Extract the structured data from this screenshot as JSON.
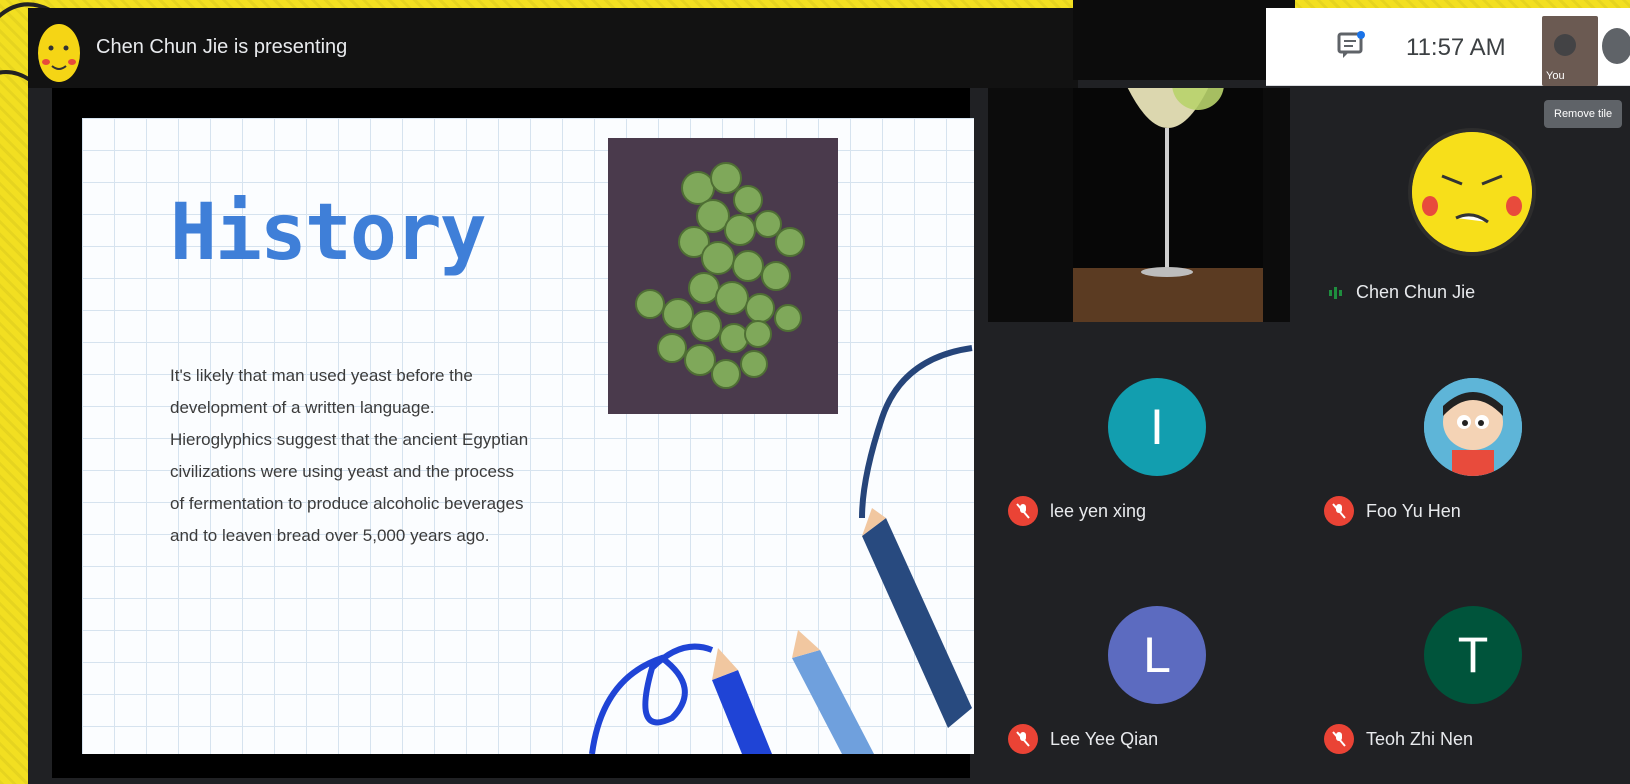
{
  "presenter_bar": {
    "text": "Chen Chun Jie is presenting"
  },
  "slide": {
    "title": "History",
    "body_lines": [
      "It's likely that man used yeast before the",
      "development of a written language.",
      "Hieroglyphics suggest that the ancient Egyptian",
      "civilizations were using yeast and the process",
      "of fermentation to produce alcoholic beverages",
      "and to leaven bread over 5,000 years ago."
    ]
  },
  "toolbar": {
    "clock": "11:57 AM",
    "self_label": "You",
    "remove_tile_tooltip": "Remove tile"
  },
  "tiles": {
    "chen": {
      "name": "Chen Chun Jie"
    },
    "participants": [
      {
        "name": "lee yen xing",
        "initial": "I",
        "color": "#129eaf",
        "muted": true
      },
      {
        "name": "Foo Yu Hen",
        "initial": "",
        "color": "#5eb5d8",
        "muted": true
      },
      {
        "name": "Lee Yee Qian",
        "initial": "L",
        "color": "#5c6bc0",
        "muted": true
      },
      {
        "name": "Teoh Zhi Nen",
        "initial": "T",
        "color": "#00543b",
        "muted": true
      }
    ]
  },
  "colors": {
    "background": "#f2df21",
    "meet_bg": "#202124",
    "title_blue": "#3f7fd8",
    "mute_red": "#ea4335"
  },
  "icons": [
    "chat-icon",
    "mic-off-icon",
    "speaking-indicator-icon",
    "more-icon"
  ]
}
